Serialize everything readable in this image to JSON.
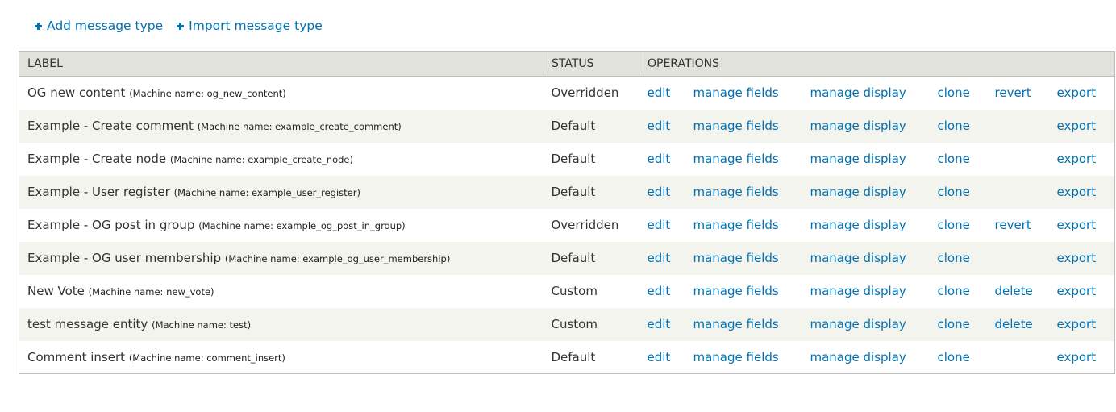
{
  "actions": {
    "add_label": "Add message type",
    "import_label": "Import message type"
  },
  "table": {
    "headers": {
      "label": "LABEL",
      "status": "STATUS",
      "operations": "OPERATIONS"
    },
    "rows": [
      {
        "label": "OG new content",
        "machine": "(Machine name: og_new_content)",
        "status": "Overridden",
        "ops": {
          "edit": "edit",
          "fields": "manage fields",
          "display": "manage display",
          "clone": "clone",
          "extra": "revert",
          "export": "export"
        }
      },
      {
        "label": "Example - Create comment",
        "machine": "(Machine name: example_create_comment)",
        "status": "Default",
        "ops": {
          "edit": "edit",
          "fields": "manage fields",
          "display": "manage display",
          "clone": "clone",
          "extra": "",
          "export": "export"
        }
      },
      {
        "label": "Example - Create node",
        "machine": "(Machine name: example_create_node)",
        "status": "Default",
        "ops": {
          "edit": "edit",
          "fields": "manage fields",
          "display": "manage display",
          "clone": "clone",
          "extra": "",
          "export": "export"
        }
      },
      {
        "label": "Example - User register",
        "machine": "(Machine name: example_user_register)",
        "status": "Default",
        "ops": {
          "edit": "edit",
          "fields": "manage fields",
          "display": "manage display",
          "clone": "clone",
          "extra": "",
          "export": "export"
        }
      },
      {
        "label": "Example - OG post in group",
        "machine": "(Machine name: example_og_post_in_group)",
        "status": "Overridden",
        "ops": {
          "edit": "edit",
          "fields": "manage fields",
          "display": "manage display",
          "clone": "clone",
          "extra": "revert",
          "export": "export"
        }
      },
      {
        "label": "Example - OG user membership",
        "machine": "(Machine name: example_og_user_membership)",
        "status": "Default",
        "ops": {
          "edit": "edit",
          "fields": "manage fields",
          "display": "manage display",
          "clone": "clone",
          "extra": "",
          "export": "export"
        }
      },
      {
        "label": "New Vote",
        "machine": "(Machine name: new_vote)",
        "status": "Custom",
        "ops": {
          "edit": "edit",
          "fields": "manage fields",
          "display": "manage display",
          "clone": "clone",
          "extra": "delete",
          "export": "export"
        }
      },
      {
        "label": "test message entity",
        "machine": "(Machine name: test)",
        "status": "Custom",
        "ops": {
          "edit": "edit",
          "fields": "manage fields",
          "display": "manage display",
          "clone": "clone",
          "extra": "delete",
          "export": "export"
        }
      },
      {
        "label": "Comment insert",
        "machine": "(Machine name: comment_insert)",
        "status": "Default",
        "ops": {
          "edit": "edit",
          "fields": "manage fields",
          "display": "manage display",
          "clone": "clone",
          "extra": "",
          "export": "export"
        }
      }
    ]
  }
}
